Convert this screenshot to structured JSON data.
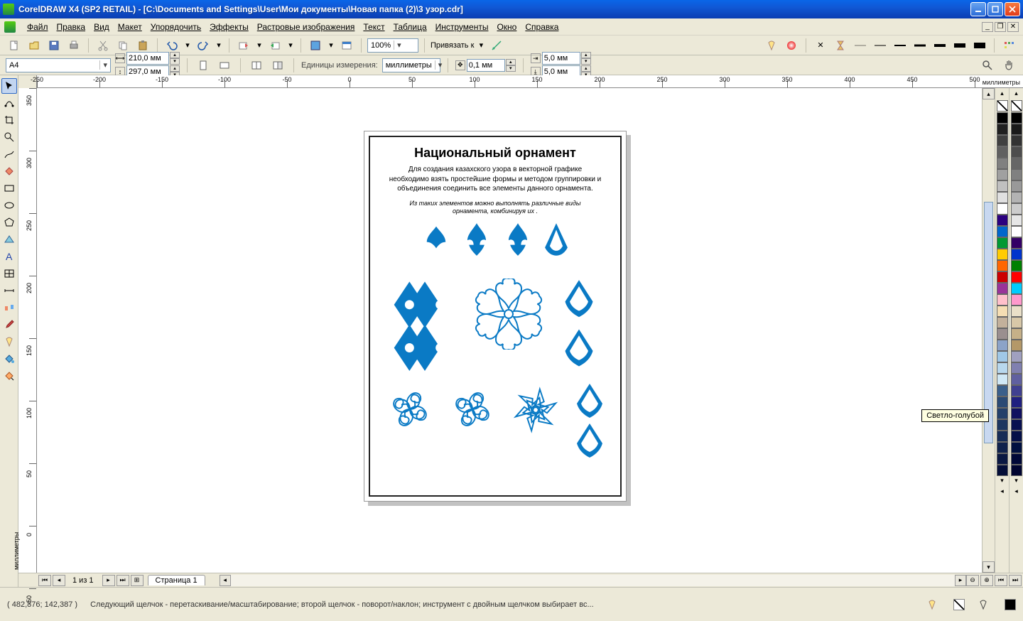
{
  "titlebar": {
    "text": "CorelDRAW X4 (SP2 RETAIL) - [C:\\Documents and Settings\\User\\Мои документы\\Новая папка (2)\\3 узор.cdr]"
  },
  "menu": {
    "items": [
      "Файл",
      "Правка",
      "Вид",
      "Макет",
      "Упорядочить",
      "Эффекты",
      "Растровые изображения",
      "Текст",
      "Таблица",
      "Инструменты",
      "Окно",
      "Справка"
    ]
  },
  "toolbar1": {
    "zoom": "100%",
    "snap_label": "Привязать к"
  },
  "propbar": {
    "paper": "A4",
    "width": "210,0 мм",
    "height": "297,0 мм",
    "units_label": "Единицы измерения:",
    "units": "миллиметры",
    "nudge": "0,1 мм",
    "dupx": "5,0 мм",
    "dupy": "5,0 мм"
  },
  "ruler": {
    "units": "миллиметры"
  },
  "document": {
    "title": "Национальный орнамент",
    "subtitle": "Для создания казахского узора в векторной графике необходимо взять простейшие формы и методом группировки и объединения соединить все элементы данного орнамента.",
    "note": "Из таких элементов можно выполнять различные виды орнамента, комбинируя их ."
  },
  "tooltip": "Светло-голубой",
  "pagenav": {
    "counter": "1 из 1",
    "tab": "Страница 1"
  },
  "status": {
    "coords": "( 482,876; 142,387 )",
    "hint": "Следующий щелчок - перетаскивание/масштабирование; второй щелчок - поворот/наклон; инструмент с двойным щелчком выбирает вс..."
  },
  "palette1": [
    "#000000",
    "#202020",
    "#404040",
    "#606060",
    "#808080",
    "#a0a0a0",
    "#c0c0c0",
    "#e0e0e0",
    "#ffffff",
    "#2b007f",
    "#0066cc",
    "#009933",
    "#ffcc00",
    "#ff6600",
    "#cc0000",
    "#993399",
    "#ffc0cb",
    "#f5deb3",
    "#c3b19b",
    "#9a8f8f",
    "#8ba3c8",
    "#a0c8e6",
    "#b8d8ed",
    "#d0e8f5",
    "#3a5f8a",
    "#2a4a74",
    "#23406a",
    "#1c3660",
    "#162c56",
    "#10224c",
    "#0a1842",
    "#040e38"
  ],
  "palette2": [
    "#000000",
    "#1a1a1a",
    "#333333",
    "#4d4d4d",
    "#666666",
    "#808080",
    "#999999",
    "#b3b3b3",
    "#cccccc",
    "#e6e6e6",
    "#ffffff",
    "#330066",
    "#0033cc",
    "#008000",
    "#ff0000",
    "#00ccff",
    "#ff99cc",
    "#eae0c8",
    "#d8c8a8",
    "#c6b088",
    "#b49868",
    "#a0a0c0",
    "#8080b0",
    "#6060a0",
    "#404090",
    "#202080",
    "#101060",
    "#081050",
    "#041048",
    "#001040",
    "#000838",
    "#000430"
  ]
}
